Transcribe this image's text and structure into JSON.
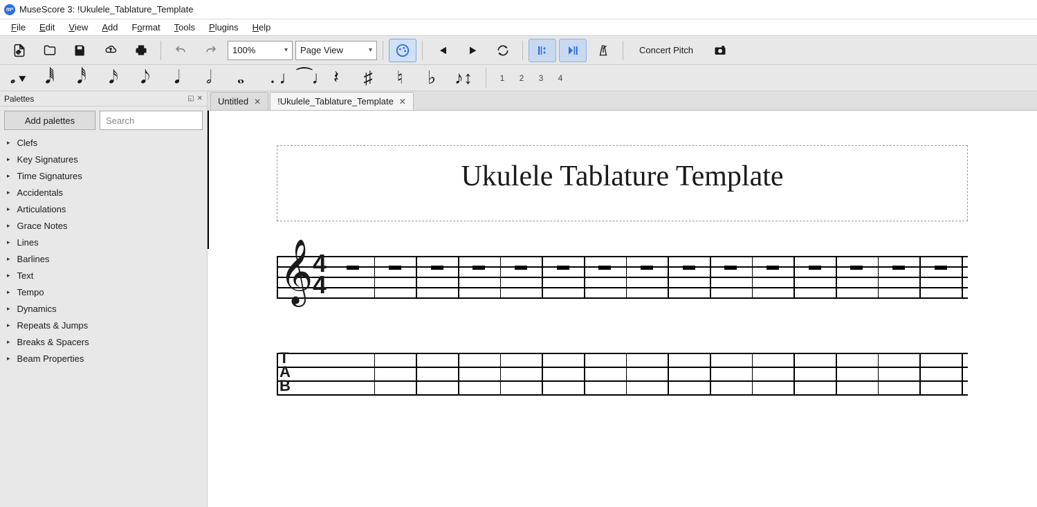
{
  "window_title": "MuseScore 3: !Ukulele_Tablature_Template",
  "app_abbrev": "mᶸ",
  "menu": [
    "File",
    "Edit",
    "View",
    "Add",
    "Format",
    "Tools",
    "Plugins",
    "Help"
  ],
  "toolbar": {
    "zoom": "100%",
    "view_mode": "Page View",
    "concert_pitch": "Concert Pitch"
  },
  "note_voices": [
    "1",
    "2",
    "3",
    "4"
  ],
  "palettes": {
    "title": "Palettes",
    "add_button": "Add palettes",
    "search_placeholder": "Search",
    "items": [
      "Clefs",
      "Key Signatures",
      "Time Signatures",
      "Accidentals",
      "Articulations",
      "Grace Notes",
      "Lines",
      "Barlines",
      "Text",
      "Tempo",
      "Dynamics",
      "Repeats & Jumps",
      "Breaks & Spacers",
      "Beam Properties"
    ]
  },
  "tabs": [
    {
      "label": "Untitled",
      "active": false
    },
    {
      "label": "!Ukulele_Tablature_Template",
      "active": true
    }
  ],
  "score": {
    "title": "Ukulele Tablature Template",
    "time_sig_top": "4",
    "time_sig_bottom": "4",
    "tab_label_t": "T",
    "tab_label_a": "A",
    "tab_label_b": "B",
    "measures": 15
  }
}
